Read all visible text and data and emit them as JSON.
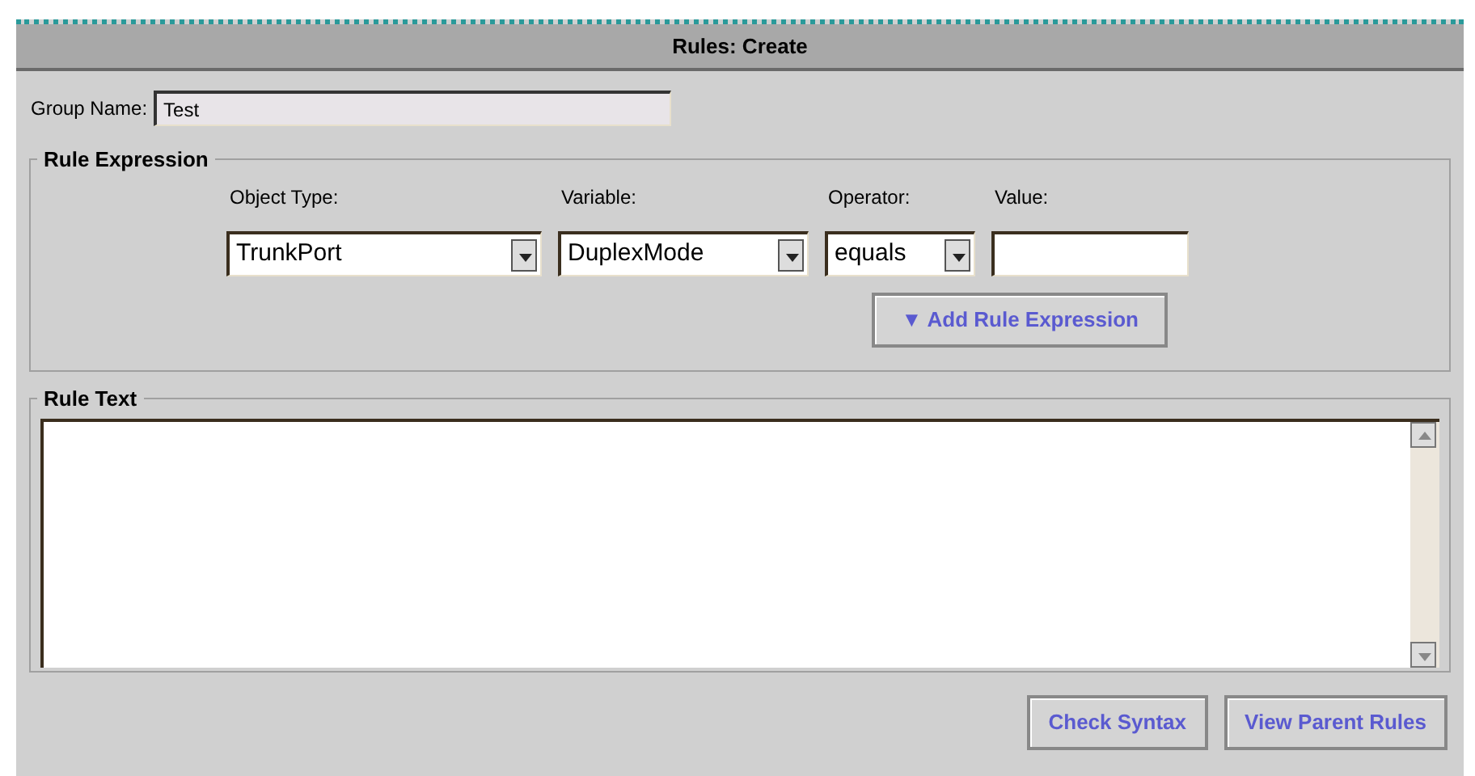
{
  "window": {
    "title": "Rules: Create"
  },
  "group_name": {
    "label": "Group Name:",
    "value": "Test"
  },
  "rule_expression": {
    "legend": "Rule Expression",
    "fields": [
      {
        "label": "Object Type:",
        "kind": "dropdown",
        "value": "TrunkPort"
      },
      {
        "label": "Variable:",
        "kind": "dropdown",
        "value": "DuplexMode"
      },
      {
        "label": "Operator:",
        "kind": "dropdown",
        "value": "equals"
      },
      {
        "label": "Value:",
        "kind": "text"
      }
    ],
    "add_button": {
      "icon": "▼",
      "label": "Add Rule Expression"
    }
  },
  "rule_text": {
    "legend": "Rule Text"
  },
  "buttons": [
    "Check Syntax",
    "View Parent Rules"
  ]
}
